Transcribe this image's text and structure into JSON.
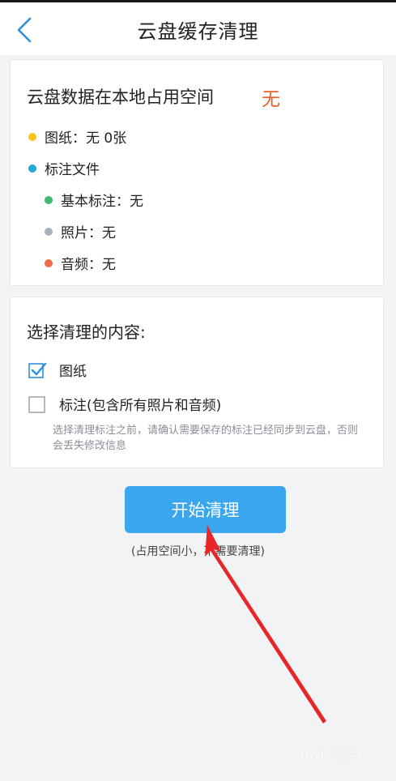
{
  "header": {
    "back_icon": "chevron-left-icon",
    "title": "云盘缓存清理"
  },
  "usage_card": {
    "heading": "云盘数据在本地占用空间",
    "total": "无",
    "items": [
      {
        "label": "图纸：无 0张",
        "color": "#f5c31b"
      },
      {
        "label": "标注文件",
        "color": "#22a7d9"
      }
    ],
    "sub_items": [
      {
        "label": "基本标注：无",
        "color": "#3dba6f"
      },
      {
        "label": "照片：无",
        "color": "#a9b2c3"
      },
      {
        "label": "音频：无",
        "color": "#ef6a45"
      }
    ]
  },
  "select_card": {
    "heading": "选择清理的内容:",
    "options": [
      {
        "label": "图纸",
        "checked": true
      },
      {
        "label": "标注(包含所有照片和音频)",
        "checked": false
      }
    ],
    "note": "选择清理标注之前，请确认需要保存的标注已经同步到云盘，否则会丢失修改信息"
  },
  "actions": {
    "start_label": "开始清理",
    "hint": "(占用空间小，不需要清理)"
  },
  "colors": {
    "accent": "#3aa6ee",
    "value_highlight": "#e8632a",
    "annotation_arrow": "#e8262a"
  },
  "watermark": "Bai 经验"
}
